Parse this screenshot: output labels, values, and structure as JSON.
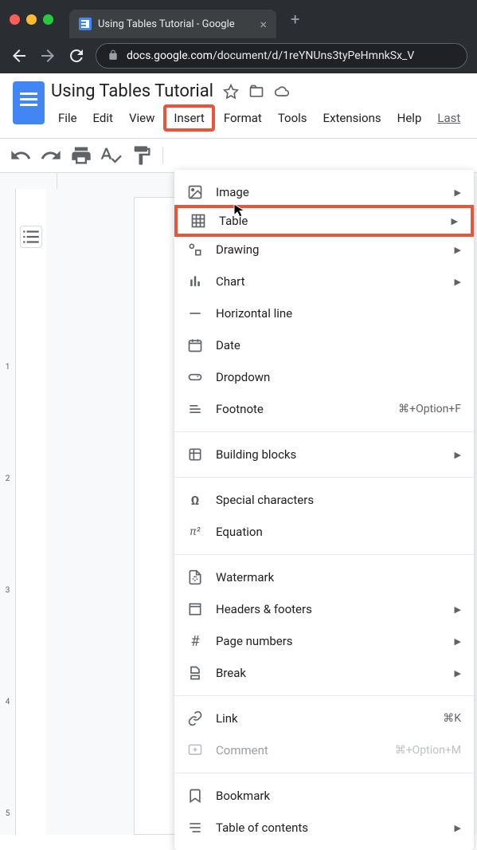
{
  "browser": {
    "tab_title": "Using Tables Tutorial - Google",
    "url_domain": "docs.google.com",
    "url_path": "/document/d/1reYNUns3tyPeHmnkSx_V"
  },
  "docs": {
    "title": "Using Tables Tutorial",
    "menubar": [
      "File",
      "Edit",
      "View",
      "Insert",
      "Format",
      "Tools",
      "Extensions",
      "Help"
    ],
    "menubar_last": "Last"
  },
  "ruler": {
    "mark_h": "1",
    "marks_v": [
      "1",
      "2",
      "3",
      "4",
      "5"
    ]
  },
  "dropdown": {
    "items": [
      {
        "icon": "image",
        "label": "Image",
        "submenu": true
      },
      {
        "icon": "table",
        "label": "Table",
        "submenu": true,
        "highlight": true
      },
      {
        "icon": "drawing",
        "label": "Drawing",
        "submenu": true
      },
      {
        "icon": "chart",
        "label": "Chart",
        "submenu": true
      },
      {
        "icon": "hline",
        "label": "Horizontal line"
      },
      {
        "icon": "date",
        "label": "Date"
      },
      {
        "icon": "dropdown",
        "label": "Dropdown"
      },
      {
        "icon": "footnote",
        "label": "Footnote",
        "shortcut": "⌘+Option+F"
      },
      {
        "sep": true
      },
      {
        "icon": "blocks",
        "label": "Building blocks",
        "submenu": true
      },
      {
        "sep": true
      },
      {
        "icon": "omega",
        "label": "Special characters"
      },
      {
        "icon": "equation",
        "label": "Equation"
      },
      {
        "sep": true
      },
      {
        "icon": "watermark",
        "label": "Watermark"
      },
      {
        "icon": "headers",
        "label": "Headers & footers",
        "submenu": true
      },
      {
        "icon": "hash",
        "label": "Page numbers",
        "submenu": true
      },
      {
        "icon": "break",
        "label": "Break",
        "submenu": true
      },
      {
        "sep": true
      },
      {
        "icon": "link",
        "label": "Link",
        "shortcut": "⌘K"
      },
      {
        "icon": "comment",
        "label": "Comment",
        "shortcut": "⌘+Option+M",
        "disabled": true
      },
      {
        "sep": true
      },
      {
        "icon": "bookmark",
        "label": "Bookmark"
      },
      {
        "icon": "toc",
        "label": "Table of contents",
        "submenu": true
      }
    ]
  }
}
